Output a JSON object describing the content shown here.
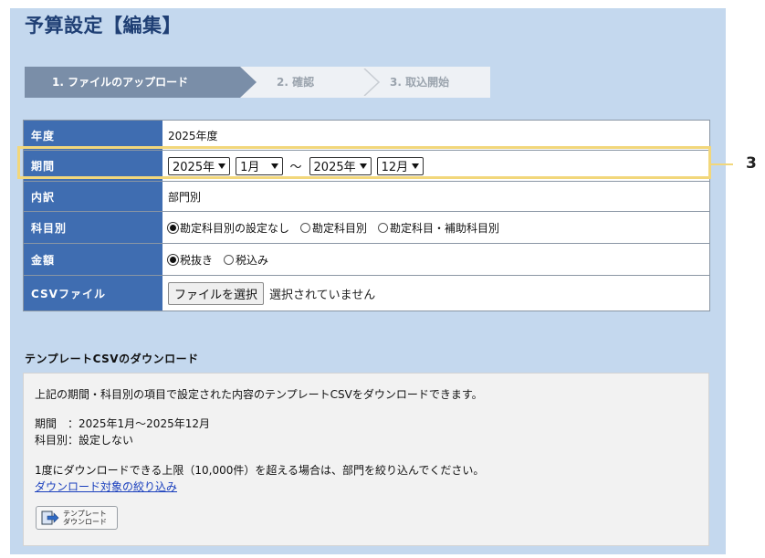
{
  "page_title": "予算設定【編集】",
  "steps": [
    "1. ファイルのアップロード",
    "2. 確認",
    "3. 取込開始"
  ],
  "form": {
    "year_label": "年度",
    "year_value": "2025年度",
    "period_label": "期間",
    "period_from_year": "2025年",
    "period_from_month": "1月",
    "period_tilde": "～",
    "period_to_year": "2025年",
    "period_to_month": "12月",
    "breakdown_label": "内訳",
    "breakdown_value": "部門別",
    "account_label": "科目別",
    "account_options": [
      "勘定科目別の設定なし",
      "勘定科目別",
      "勘定科目・補助科目別"
    ],
    "account_selected": 0,
    "amount_label": "金額",
    "amount_options": [
      "税抜き",
      "税込み"
    ],
    "amount_selected": 0,
    "csv_label": "CSVファイル",
    "file_button": "ファイルを選択",
    "file_status": "選択されていません"
  },
  "callout": "3",
  "download": {
    "title": "テンプレートCSVのダウンロード",
    "description": "上記の期間・科目別の項目で設定された内容のテンプレートCSVをダウンロードできます。",
    "period_line": "期間　：2025年1月～2025年12月",
    "account_line": "科目別：設定しない",
    "limit_note": "1度にダウンロードできる上限（10,000件）を超える場合は、部門を絞り込んでください。",
    "filter_link": "ダウンロード対象の絞り込み",
    "button_line1": "テンプレート",
    "button_line2": "ダウンロード"
  }
}
